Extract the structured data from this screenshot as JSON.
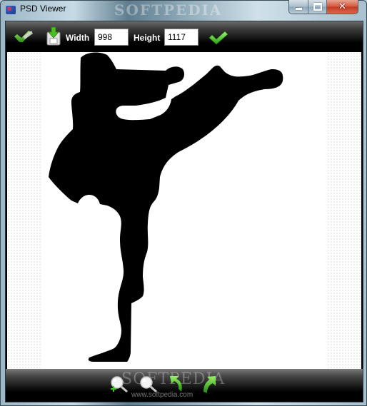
{
  "window": {
    "title": "PSD Viewer",
    "watermark": "SOFTPEDIA",
    "controls": {
      "minimize": "minimize",
      "maximize": "maximize",
      "close": "close",
      "close_glyph": "✕"
    }
  },
  "toolbar": {
    "open_icon": "open-folder-icon",
    "save_icon": "save-icon",
    "width_label": "Width",
    "width_value": "998",
    "height_label": "Height",
    "height_value": "1117",
    "apply_icon": "checkmark-icon"
  },
  "canvas": {
    "image_description": "black karate kick silhouette on white background"
  },
  "bottombar": {
    "buttons": [
      {
        "name": "zoom-in",
        "icon": "zoom-in-icon"
      },
      {
        "name": "zoom-out",
        "icon": "zoom-out-icon"
      },
      {
        "name": "rotate-left",
        "icon": "rotate-left-icon"
      },
      {
        "name": "rotate-right",
        "icon": "rotate-right-icon"
      }
    ],
    "watermark": "SOFTPEDIA",
    "watermark_url": "www.softpedia.com"
  },
  "colors": {
    "accent_green": "#3fbf1f",
    "toolbar_bg": "#000000",
    "close_red": "#c8402a"
  }
}
